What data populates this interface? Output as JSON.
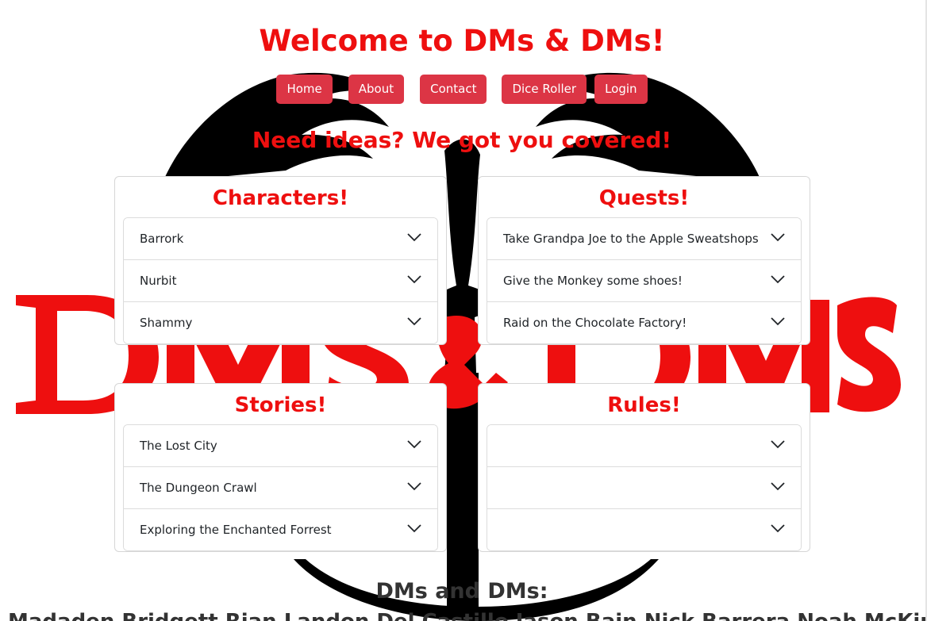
{
  "header": {
    "title": "Welcome to DMs & DMs!"
  },
  "nav": {
    "items": [
      "Home",
      "About",
      "Contact",
      "Dice Roller",
      "Login"
    ]
  },
  "tagline": "Need ideas? We got you covered!",
  "cards": {
    "characters": {
      "title": "Characters!",
      "items": [
        "Barrork",
        "Nurbit",
        "Shammy"
      ]
    },
    "quests": {
      "title": "Quests!",
      "items": [
        "Take Grandpa Joe to the Apple Sweatshops",
        "Give the Monkey some shoes!",
        "Raid on the Chocolate Factory!"
      ]
    },
    "stories": {
      "title": "Stories!",
      "items": [
        "The Lost City",
        "The Dungeon Crawl",
        "Exploring the Enchanted Forrest"
      ]
    },
    "rules": {
      "title": "Rules!",
      "items": [
        "",
        "",
        ""
      ]
    }
  },
  "footer": {
    "heading": "DMs and DMs:",
    "names": "Madaden Bridgett  Rian  Landon  Del Castillo  Jason Bain  Nick Barrera  Noah McKinzie  and"
  },
  "colors": {
    "accent": "#ee0f0f",
    "button": "#dc3545",
    "logo_black": "#000000"
  }
}
